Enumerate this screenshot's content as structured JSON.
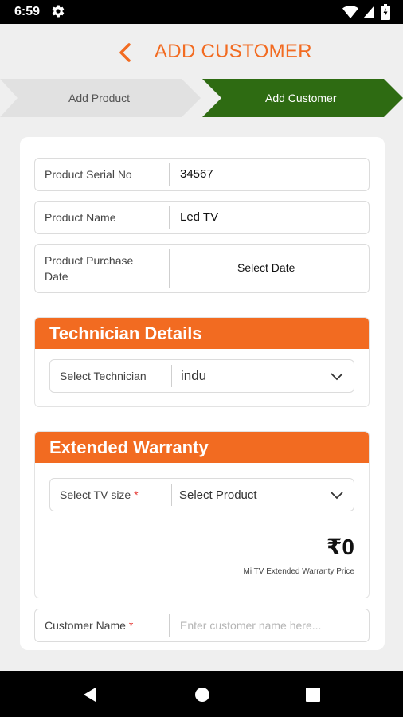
{
  "status_bar": {
    "time": "6:59",
    "icons": [
      "gear-icon",
      "wifi-icon",
      "cellular-signal-icon",
      "battery-icon"
    ]
  },
  "header": {
    "title": "ADD CUSTOMER",
    "back_icon": "chevron-left-icon"
  },
  "stepper": {
    "steps": [
      {
        "label": "Add Product",
        "state": "completed"
      },
      {
        "label": "Add Customer",
        "state": "active"
      }
    ]
  },
  "product": {
    "serial": {
      "label": "Product Serial No",
      "value": "34567"
    },
    "name": {
      "label": "Product Name",
      "value": "Led TV"
    },
    "purchase_date": {
      "label_line1": "Product Purchase",
      "label_line2": "Date",
      "value": "Select Date"
    }
  },
  "technician": {
    "title": "Technician Details",
    "select_label": "Select Technician",
    "selected": "indu"
  },
  "warranty": {
    "title": "Extended Warranty",
    "tv_size_label": "Select TV size",
    "required_mark": "*",
    "tv_size_selected": "Select Product",
    "price": "₹0",
    "price_caption": "Mi TV Extended Warranty Price"
  },
  "customer": {
    "name_label": "Customer Name",
    "required_mark": "*",
    "name_placeholder": "Enter customer name here..."
  },
  "colors": {
    "accent": "#f26b21",
    "active_step": "#2e6b12",
    "inactive_step": "#e1e1e1",
    "required": "#e53935"
  },
  "nav_bar": {
    "buttons": [
      "back-triangle-icon",
      "home-circle-icon",
      "recents-square-icon"
    ]
  }
}
